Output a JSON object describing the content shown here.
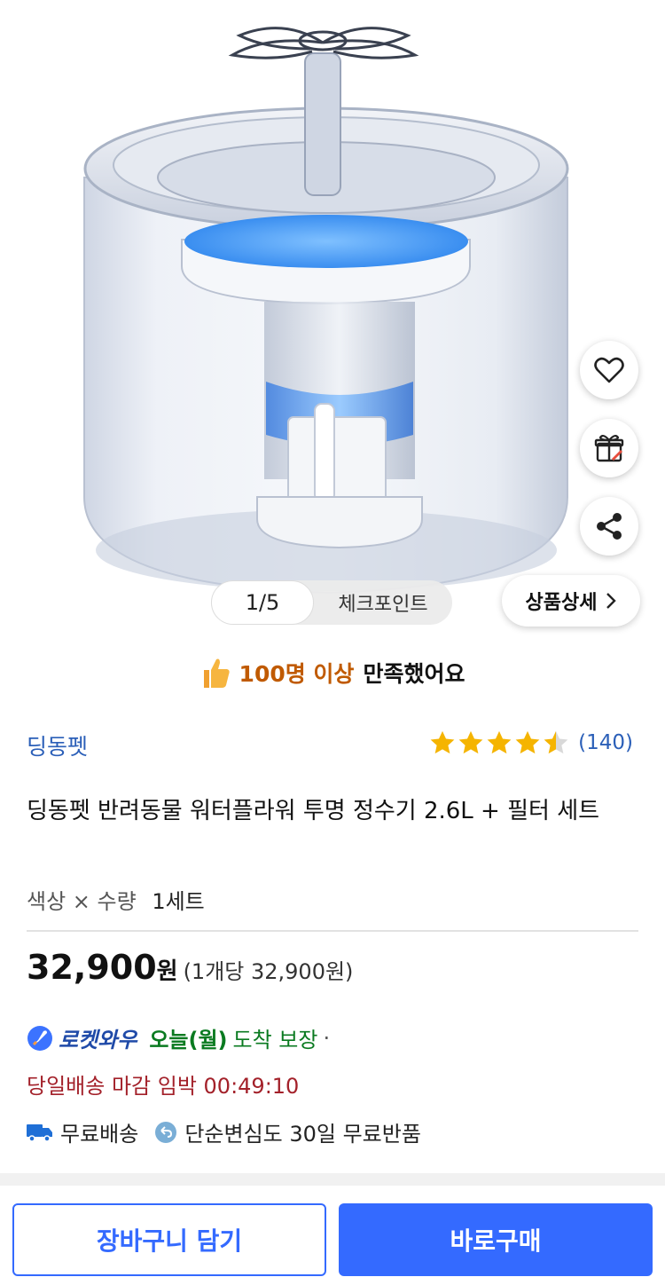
{
  "hero": {
    "pager": {
      "current": "1/5",
      "checkpoint_label": "체크포인트"
    },
    "detail_button_label": "상품상세",
    "side_buttons": [
      "heart-icon",
      "gift-icon",
      "share-icon"
    ]
  },
  "satisfaction": {
    "highlight": "100명 이상",
    "rest": "만족했어요"
  },
  "product": {
    "brand": "딩동펫",
    "rating_stars": 4.5,
    "review_count": "(140)",
    "title": "딩동펫 반려동물 워터플라워 투명 정수기 2.6L + 필터 세트",
    "option_label": "색상 × 수량",
    "option_value": "1세트"
  },
  "price": {
    "amount": "32,900",
    "currency": "원",
    "unit_price": "(1개당 32,900원)"
  },
  "delivery": {
    "rocket_label": "로켓와우",
    "today": "오늘(월)",
    "arrival": "도착 보장",
    "dot": "·",
    "deadline": "당일배송 마감 임박 00:49:10",
    "free_shipping": "무료배송",
    "return_policy": "단순변심도 30일 무료반품"
  },
  "bottom": {
    "cart_label": "장바구니 담기",
    "buy_label": "바로구매"
  },
  "colors": {
    "accent": "#346aff",
    "brand_link": "#2b5fb8",
    "star": "#f5b400",
    "deadline": "#a3212a",
    "arrival": "#0a7a20"
  }
}
